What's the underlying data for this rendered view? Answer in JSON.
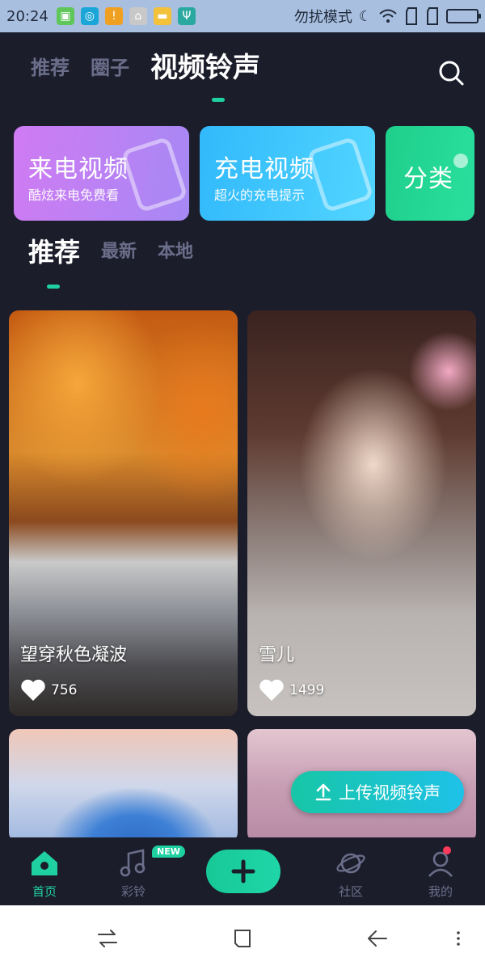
{
  "status_bar": {
    "time": "20:24",
    "dnd_label": "勿扰模式"
  },
  "top_tabs": [
    {
      "label": "推荐",
      "active": false
    },
    {
      "label": "圈子",
      "active": false
    },
    {
      "label": "视频铃声",
      "active": true
    }
  ],
  "banners": [
    {
      "title": "来电视频",
      "subtitle": "酷炫来电免费看"
    },
    {
      "title": "充电视频",
      "subtitle": "超火的充电提示"
    },
    {
      "title": "分类",
      "subtitle": ""
    }
  ],
  "sub_tabs": [
    {
      "label": "推荐",
      "active": true
    },
    {
      "label": "最新",
      "active": false
    },
    {
      "label": "本地",
      "active": false
    }
  ],
  "videos": [
    {
      "title": "望穿秋色凝波",
      "likes": "756"
    },
    {
      "title": "雪儿",
      "likes": "1499"
    },
    {
      "title": "",
      "likes": ""
    },
    {
      "title": "",
      "likes": ""
    }
  ],
  "upload_button": {
    "label": "上传视频铃声"
  },
  "bottom_nav": {
    "home": "首页",
    "ring": "彩铃",
    "ring_badge": "NEW",
    "social": "社区",
    "me": "我的"
  },
  "colors": {
    "background": "#1c1d2b",
    "accent": "#1fd1a1",
    "inactive_text": "#6b6e8a"
  },
  "icons": [
    "search-icon",
    "home-icon",
    "music-note-icon",
    "plus-icon",
    "planet-icon",
    "person-icon",
    "upload-icon",
    "heart-icon"
  ]
}
